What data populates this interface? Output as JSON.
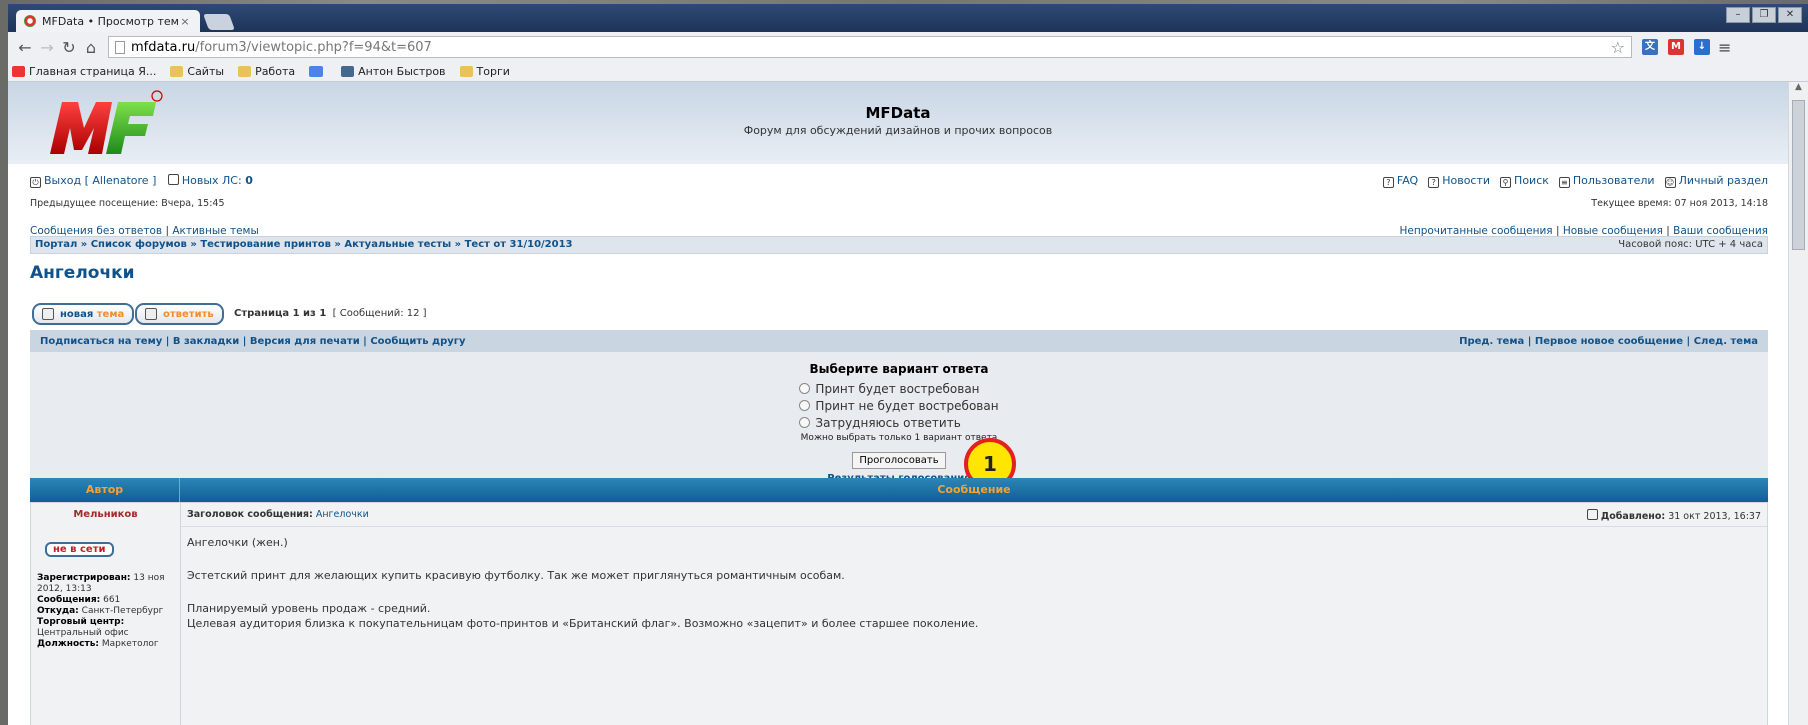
{
  "browser": {
    "tab_title": "MFData • Просмотр темы",
    "tab_close": "×",
    "url_host": "mfdata.ru",
    "url_path": "/forum3/viewtopic.php?f=94&t=607",
    "window_controls": [
      "–",
      "❐",
      "✕"
    ],
    "bookmarks": [
      {
        "label": "Главная страница Я...",
        "icon": "yandex-icon"
      },
      {
        "label": "Сайты",
        "icon": "folder-icon"
      },
      {
        "label": "Работа",
        "icon": "folder-icon"
      },
      {
        "label": "",
        "icon": "google-icon"
      },
      {
        "label": "Антон Быстров",
        "icon": "vk-icon"
      },
      {
        "label": "Торги",
        "icon": "folder-icon"
      }
    ]
  },
  "site": {
    "title": "MFData",
    "description": "Форум для обсуждений дизайнов и прочих вопросов",
    "logo_text": "MF"
  },
  "user": {
    "logout": "Выход [ Allenatore ]",
    "pm_label": "Новых ЛС:",
    "pm_count": "0",
    "last_visit": "Предыдущее посещение: Вчера, 15:45",
    "current_time": "Текущее время: 07 ноя 2013, 14:18"
  },
  "topnav": [
    "FAQ",
    "Новости",
    "Поиск",
    "Пользователи",
    "Личный раздел"
  ],
  "quicklinks_left": [
    "Сообщения без ответов",
    "Активные темы"
  ],
  "quicklinks_right": [
    "Непрочитанные сообщения",
    "Новые сообщения",
    "Ваши сообщения"
  ],
  "breadcrumb": [
    "Портал",
    "Список форумов",
    "Тестирование принтов",
    "Актуальные тесты",
    "Тест от 31/10/2013"
  ],
  "timezone": "Часовой пояс: UTC + 4 часа",
  "topic_title": "Ангелочки",
  "buttons": {
    "new_a": "новая",
    "new_b": "тема",
    "reply": "ответить"
  },
  "pagination": {
    "page": "Страница 1 из 1",
    "count": "[ Сообщений: 12 ]"
  },
  "toolbar_left": "Подписаться на тему | В закладки | Версия для печати | Сообщить другу",
  "toolbar_right": "Пред. тема | Первое новое сообщение | След. тема",
  "poll": {
    "question": "Выберите вариант ответа",
    "options": [
      "Принт будет востребован",
      "Принт не будет востребован",
      "Затрудняюсь ответить"
    ],
    "note": "Можно выбрать только 1 вариант ответа",
    "vote_button": "Проголосовать",
    "results_link": "Результаты голосования"
  },
  "marker": "1",
  "table": {
    "col_author": "Автор",
    "col_message": "Сообщение"
  },
  "post": {
    "author": "Мельников",
    "status": "не в сети",
    "subject_label": "Заголовок сообщения:",
    "subject": "Ангелочки",
    "added_label": "Добавлено:",
    "added": "31 окт 2013, 16:37",
    "profile": {
      "registered_label": "Зарегистрирован:",
      "registered": "13 ноя 2012, 13:13",
      "posts_label": "Сообщения:",
      "posts": "661",
      "from_label": "Откуда:",
      "from": "Санкт-Петербург",
      "mall_label": "Торговый центр:",
      "mall": "Центральный офис",
      "position_label": "Должность:",
      "position": "Маркетолог"
    },
    "lines": [
      "Ангелочки (жен.)",
      "Эстетский принт для желающих купить красивую футболку. Так же может приглянуться романтичным особам.",
      "Планируемый уровень продаж - средний.",
      "Целевая аудитория близка к покупательницам фото-принтов и «Бритaнский флаг». Возможно «зацепит» и более старшее поколение."
    ]
  }
}
